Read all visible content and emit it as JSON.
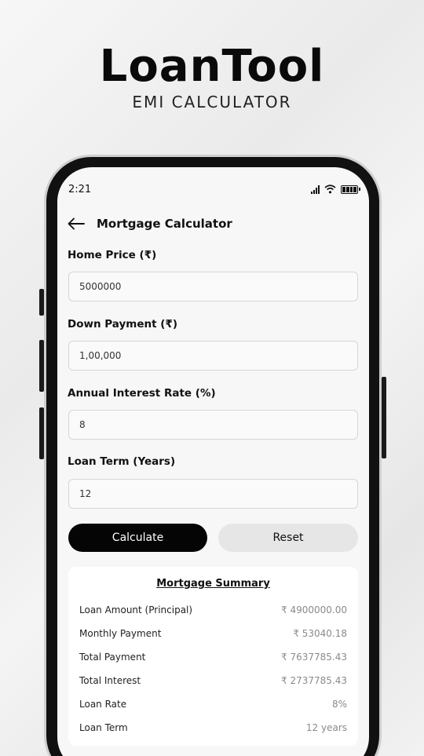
{
  "promo": {
    "title": "LoanTool",
    "subtitle": "EMI CALCULATOR"
  },
  "status_bar": {
    "time": "2:21",
    "icons": [
      "signal-icon",
      "wifi-icon",
      "battery-icon"
    ]
  },
  "header": {
    "back_icon": "arrow-left-icon",
    "title": "Mortgage Calculator"
  },
  "form": {
    "home_price": {
      "label": "Home Price (₹)",
      "value": "5000000"
    },
    "down_payment": {
      "label": "Down Payment (₹)",
      "value": "1,00,000"
    },
    "interest_rate": {
      "label": "Annual Interest Rate (%)",
      "value": "8"
    },
    "loan_term": {
      "label": "Loan Term (Years)",
      "value": "12"
    }
  },
  "buttons": {
    "calculate": "Calculate",
    "reset": "Reset"
  },
  "summary": {
    "title": "Mortgage Summary",
    "rows": [
      {
        "label": "Loan Amount (Principal)",
        "value": "₹ 4900000.00"
      },
      {
        "label": "Monthly Payment",
        "value": "₹ 53040.18"
      },
      {
        "label": "Total Payment",
        "value": "₹ 7637785.43"
      },
      {
        "label": "Total Interest",
        "value": "₹ 2737785.43"
      },
      {
        "label": "Loan Rate",
        "value": "8%"
      },
      {
        "label": "Loan Term",
        "value": "12 years"
      }
    ]
  },
  "colors": {
    "primary_button": "#050505",
    "secondary_button": "#e6e6e6",
    "screen_bg": "#f7f7f7"
  }
}
